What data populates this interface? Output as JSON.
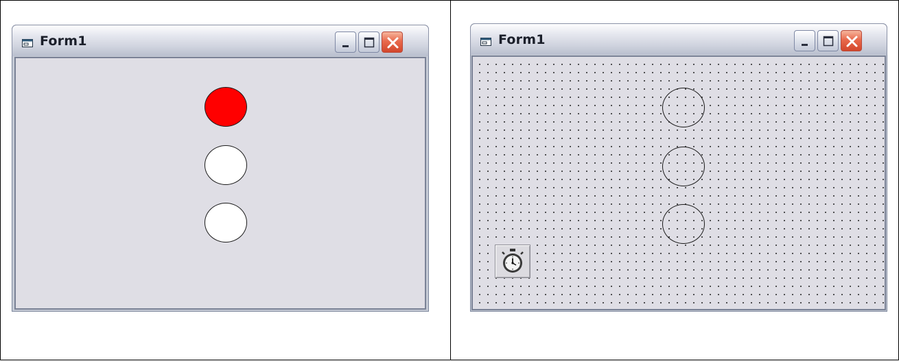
{
  "left_panel": {
    "window": {
      "title": "Form1",
      "icon": "form-icon",
      "buttons": [
        "minimize-icon",
        "maximize-icon",
        "close-icon"
      ]
    },
    "mode": "runtime",
    "lamps": [
      {
        "name": "top-lamp",
        "state": "on",
        "color": "#ff0000"
      },
      {
        "name": "middle-lamp",
        "state": "off",
        "color": "#ffffff"
      },
      {
        "name": "bottom-lamp",
        "state": "off",
        "color": "#ffffff"
      }
    ]
  },
  "right_panel": {
    "window": {
      "title": "Form1",
      "icon": "form-icon",
      "buttons": [
        "minimize-icon",
        "maximize-icon",
        "close-icon"
      ]
    },
    "mode": "design",
    "grid_dots": true,
    "lamps": [
      {
        "name": "top-lamp-outline",
        "color": "transparent"
      },
      {
        "name": "middle-lamp-outline",
        "color": "transparent"
      },
      {
        "name": "bottom-lamp-outline",
        "color": "transparent"
      }
    ],
    "timer_control": {
      "icon": "stopwatch-icon"
    }
  }
}
